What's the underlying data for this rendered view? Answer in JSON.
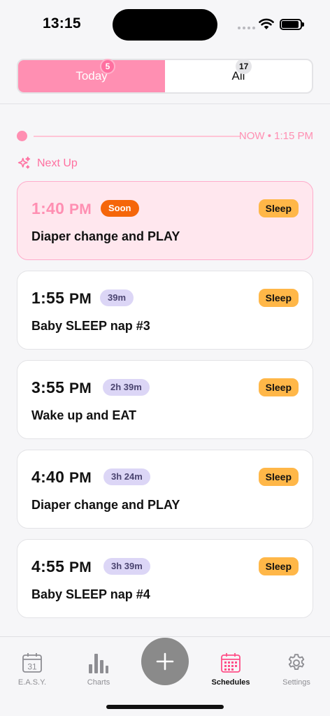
{
  "status_bar": {
    "time": "13:15"
  },
  "segmented": {
    "tabs": [
      {
        "label": "Today",
        "count": "5"
      },
      {
        "label": "All",
        "count": "17"
      }
    ]
  },
  "now_indicator": {
    "label": "NOW • 1:15 PM"
  },
  "next_up": {
    "label": "Next Up"
  },
  "schedule_items": [
    {
      "time": "1:40",
      "ampm": "PM",
      "chip": "Soon",
      "chip_type": "soon",
      "category": "Sleep",
      "title": "Diaper change and PLAY",
      "highlight": true
    },
    {
      "time": "1:55",
      "ampm": "PM",
      "chip": "39m",
      "chip_type": "duration",
      "category": "Sleep",
      "title": "Baby SLEEP nap #3",
      "highlight": false
    },
    {
      "time": "3:55",
      "ampm": "PM",
      "chip": "2h 39m",
      "chip_type": "duration",
      "category": "Sleep",
      "title": "Wake up and EAT",
      "highlight": false
    },
    {
      "time": "4:40",
      "ampm": "PM",
      "chip": "3h 24m",
      "chip_type": "duration",
      "category": "Sleep",
      "title": "Diaper change and PLAY",
      "highlight": false
    },
    {
      "time": "4:55",
      "ampm": "PM",
      "chip": "3h 39m",
      "chip_type": "duration",
      "category": "Sleep",
      "title": "Baby SLEEP nap #4",
      "highlight": false
    }
  ],
  "tab_bar": {
    "items": [
      {
        "label": "E.A.S.Y.",
        "icon": "calendar-31-icon",
        "active": false
      },
      {
        "label": "Charts",
        "icon": "bar-chart-icon",
        "active": false
      },
      {
        "label": "Schedules",
        "icon": "calendar-grid-icon",
        "active": true
      },
      {
        "label": "Settings",
        "icon": "gear-icon",
        "active": false
      }
    ],
    "calendar_day": "31",
    "fab_icon": "plus-icon"
  },
  "colors": {
    "accent_pink": "#ff8fb2",
    "soon_orange": "#f5660a",
    "sleep_tag": "#ffb748",
    "duration_chip": "#dcd6f6",
    "active_tab": "#ff4f88"
  }
}
